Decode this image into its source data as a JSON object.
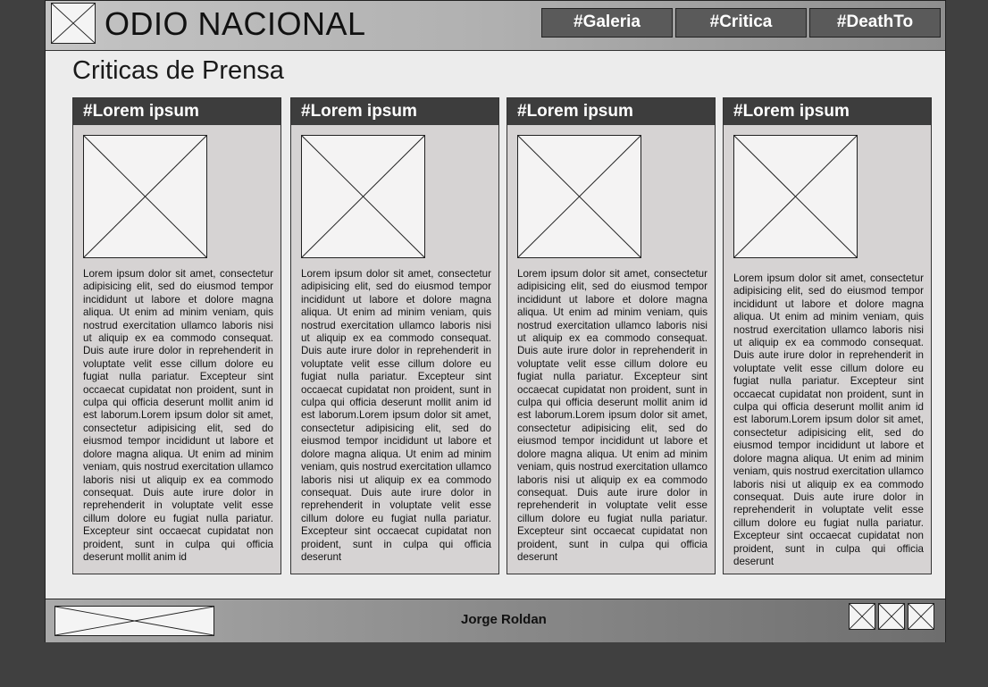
{
  "header": {
    "title": "ODIO NACIONAL",
    "logo_icon": "image-placeholder-icon",
    "nav": [
      {
        "label": "#Galeria"
      },
      {
        "label": "#Critica"
      },
      {
        "label": "#DeathTo"
      }
    ]
  },
  "main": {
    "heading": "Criticas de Prensa",
    "cards": [
      {
        "title": "#Lorem ipsum",
        "image_icon": "image-placeholder-icon",
        "text": "Lorem ipsum dolor sit amet, consectetur adipisicing elit, sed do eiusmod tempor incididunt ut labore et dolore magna aliqua. Ut enim ad minim veniam, quis nostrud exercitation ullamco laboris nisi ut aliquip ex ea commodo consequat. Duis aute irure dolor in reprehenderit in voluptate velit esse cillum dolore eu fugiat nulla pariatur. Excepteur sint occaecat cupidatat non proident, sunt in culpa qui officia deserunt mollit anim id est laborum.Lorem ipsum dolor sit amet, consectetur adipisicing elit, sed do eiusmod tempor incididunt ut labore et dolore magna aliqua. Ut enim ad minim veniam, quis nostrud exercitation ullamco laboris nisi ut aliquip ex ea commodo consequat. Duis aute irure dolor in reprehenderit in voluptate velit esse cillum dolore eu fugiat nulla pariatur. Excepteur sint occaecat cupidatat non proident, sunt in culpa qui officia deserunt mollit anim id"
      },
      {
        "title": "#Lorem ipsum",
        "image_icon": "image-placeholder-icon",
        "text": "Lorem ipsum dolor sit amet, consectetur adipisicing elit, sed do eiusmod tempor incididunt ut labore et dolore magna aliqua. Ut enim ad minim veniam, quis nostrud exercitation ullamco laboris nisi ut aliquip ex ea commodo consequat. Duis aute irure dolor in reprehenderit in voluptate velit esse cillum dolore eu fugiat nulla pariatur. Excepteur sint occaecat cupidatat non proident, sunt in culpa qui officia deserunt mollit anim id est laborum.Lorem ipsum dolor sit amet, consectetur adipisicing elit, sed do eiusmod tempor incididunt ut labore et dolore magna aliqua. Ut enim ad minim veniam, quis nostrud exercitation ullamco laboris nisi ut aliquip ex ea commodo consequat. Duis aute irure dolor in reprehenderit in voluptate velit esse cillum dolore eu fugiat nulla pariatur. Excepteur sint occaecat cupidatat non proident, sunt in culpa qui officia deserunt"
      },
      {
        "title": "#Lorem ipsum",
        "image_icon": "image-placeholder-icon",
        "text": "Lorem ipsum dolor sit amet, consectetur adipisicing elit, sed do eiusmod tempor incididunt ut labore et dolore magna aliqua. Ut enim ad minim veniam, quis nostrud exercitation ullamco laboris nisi ut aliquip ex ea commodo consequat. Duis aute irure dolor in reprehenderit in voluptate velit esse cillum dolore eu fugiat nulla pariatur. Excepteur sint occaecat cupidatat non proident, sunt in culpa qui officia deserunt mollit anim id est laborum.Lorem ipsum dolor sit amet, consectetur adipisicing elit, sed do eiusmod tempor incididunt ut labore et dolore magna aliqua. Ut enim ad minim veniam, quis nostrud exercitation ullamco laboris nisi ut aliquip ex ea commodo consequat. Duis aute irure dolor in reprehenderit in voluptate velit esse cillum dolore eu fugiat nulla pariatur. Excepteur sint occaecat cupidatat non proident, sunt in culpa qui officia deserunt"
      },
      {
        "title": "#Lorem ipsum",
        "image_icon": "image-placeholder-icon",
        "text": "Lorem ipsum dolor sit amet, consectetur adipisicing elit, sed do eiusmod tempor incididunt ut labore et dolore magna aliqua. Ut enim ad minim veniam, quis nostrud exercitation ullamco laboris nisi ut aliquip ex ea commodo consequat. Duis aute irure dolor in reprehenderit in voluptate velit esse cillum dolore eu fugiat nulla pariatur. Excepteur sint occaecat cupidatat non proident, sunt in culpa qui officia deserunt mollit anim id est laborum.Lorem ipsum dolor sit amet, consectetur adipisicing elit, sed do eiusmod tempor incididunt ut labore et dolore magna aliqua. Ut enim ad minim veniam, quis nostrud exercitation ullamco laboris nisi ut aliquip ex ea commodo consequat. Duis aute irure dolor in reprehenderit in voluptate velit esse cillum dolore eu fugiat nulla pariatur. Excepteur sint occaecat cupidatat non proident, sunt in culpa qui officia deserunt"
      }
    ]
  },
  "footer": {
    "author": "Jorge Roldan",
    "logo_icon": "image-placeholder-icon",
    "social_icons": [
      "image-placeholder-icon",
      "image-placeholder-icon",
      "image-placeholder-icon"
    ]
  },
  "colors": {
    "page_bg": "#404040",
    "nav_button": "#5a5a5a",
    "card_header": "#3d3d3d",
    "card_body": "#d6d3d3"
  }
}
